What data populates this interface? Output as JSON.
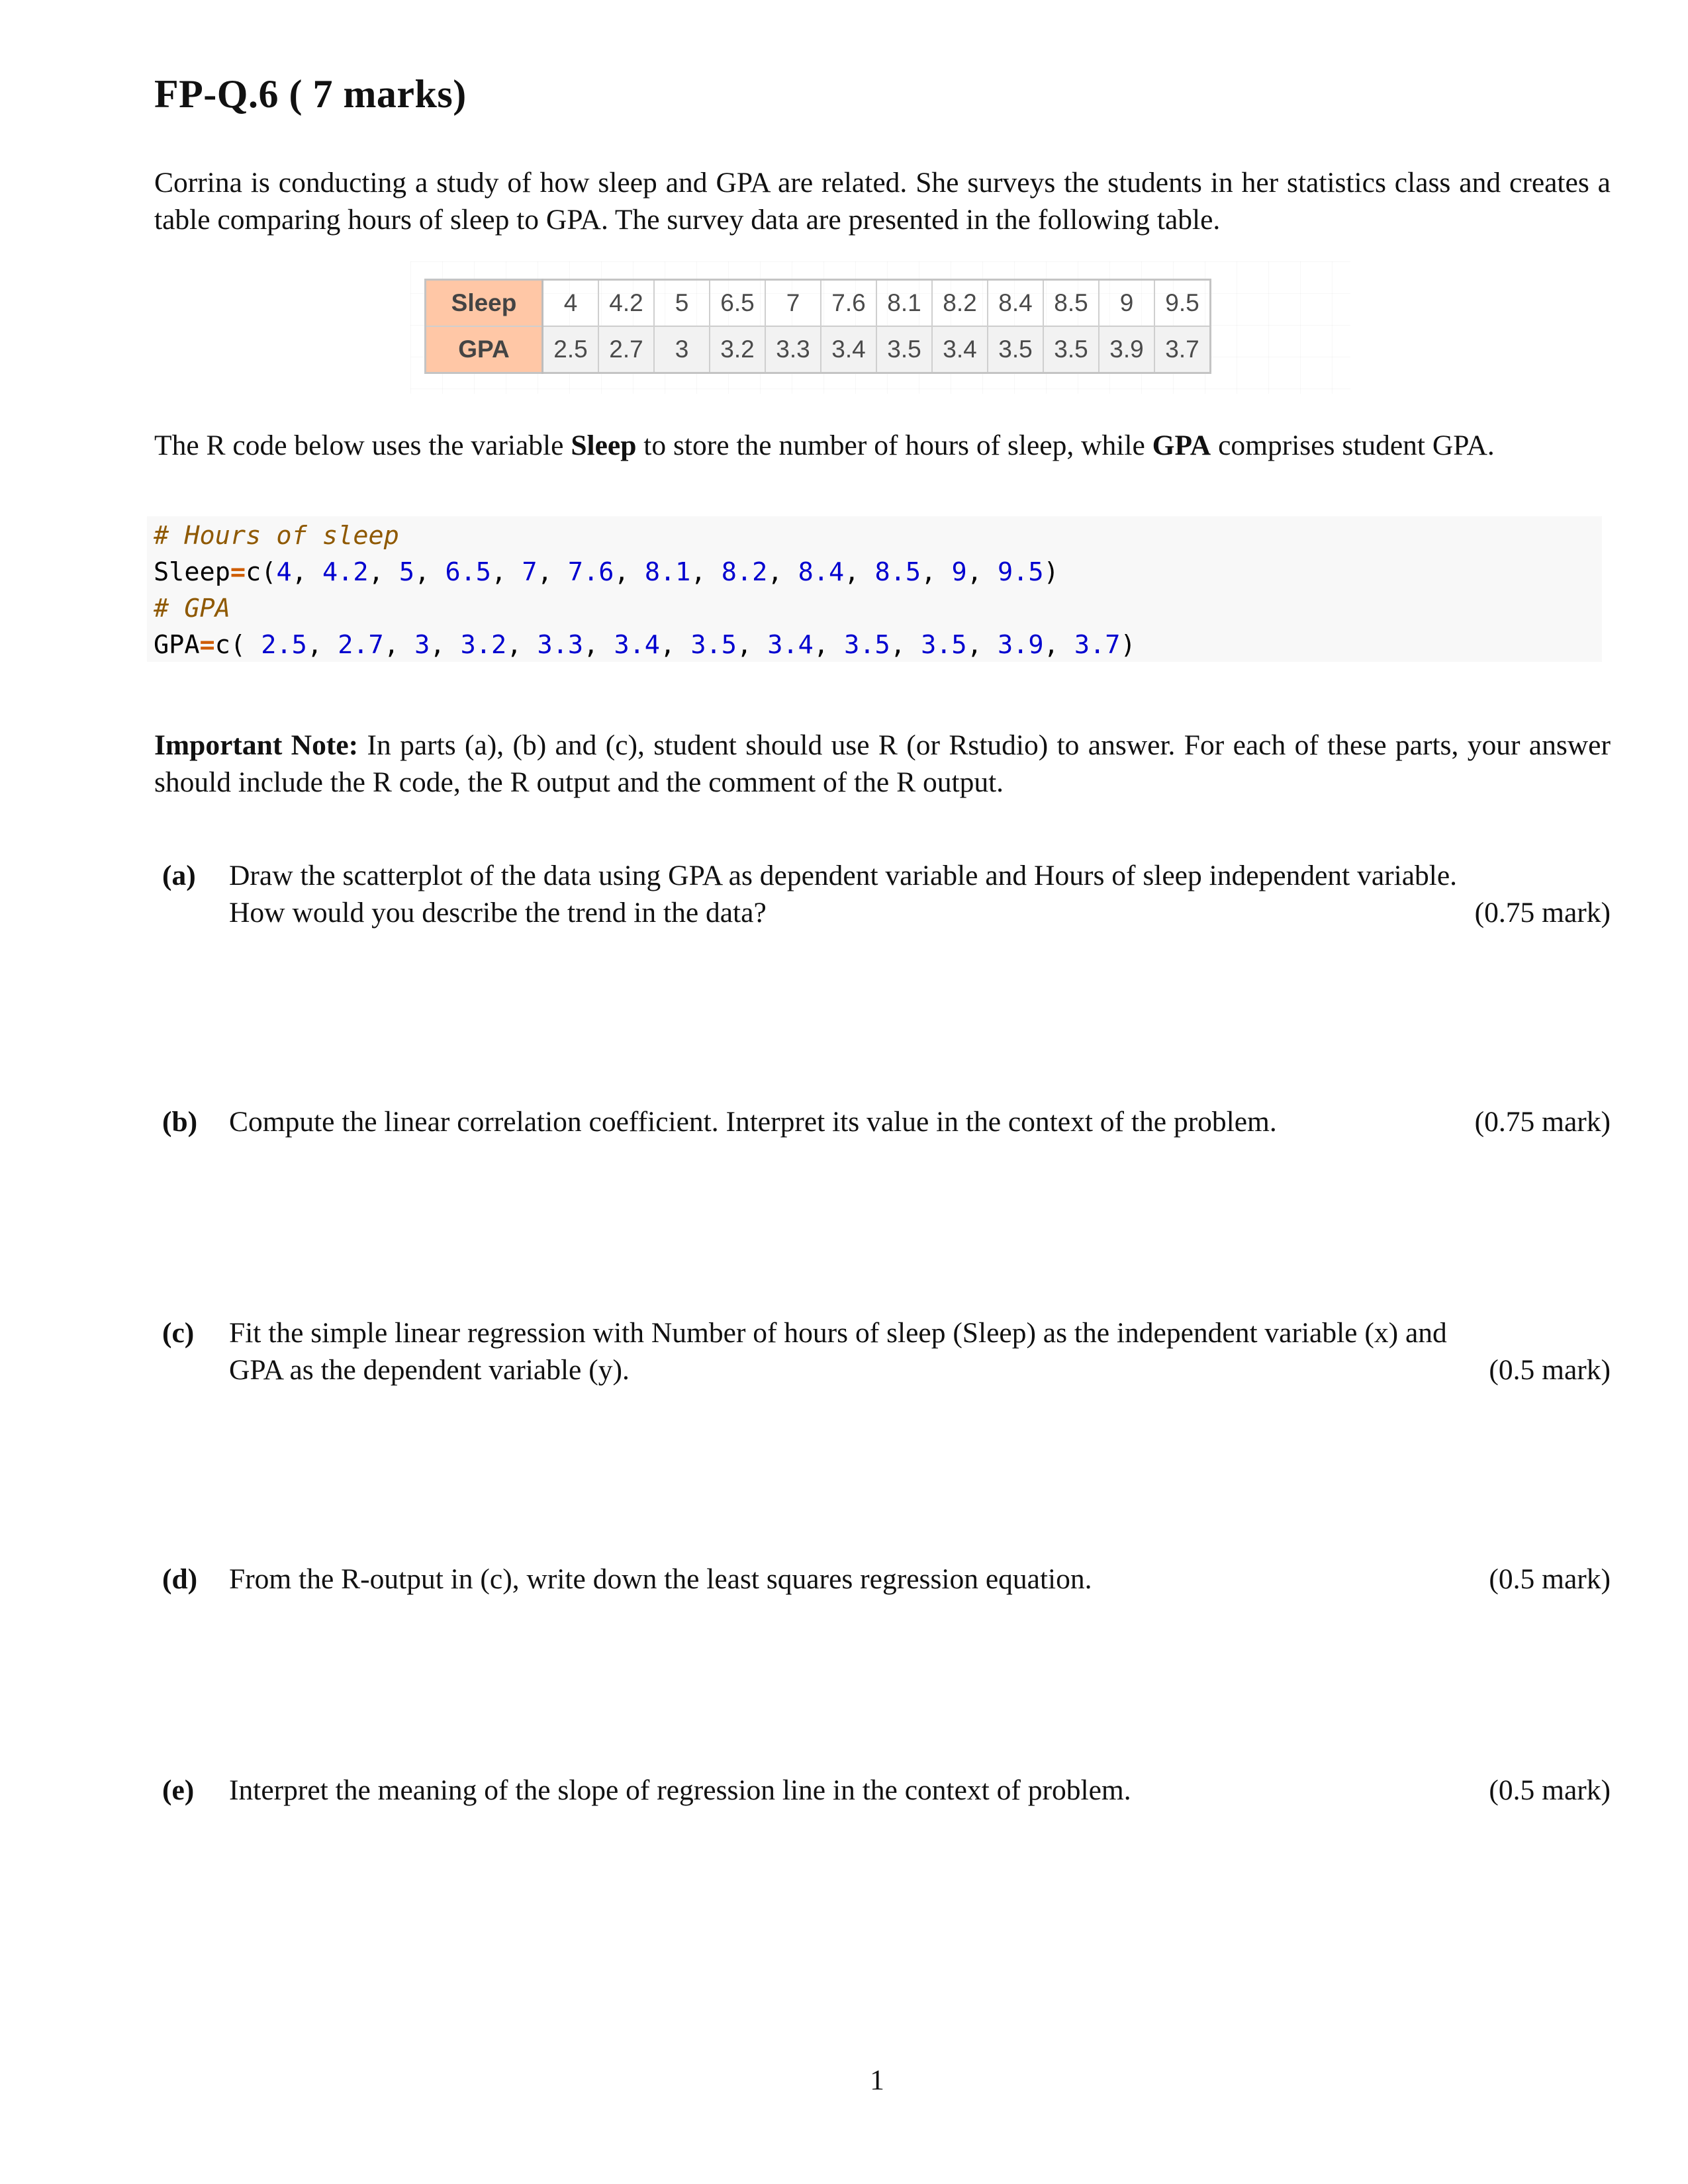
{
  "header": {
    "title_prefix": "FP-Q.6 (",
    "title_marks": "7",
    "title_suffix": "marks)"
  },
  "intro": {
    "text": "Corrina is conducting a study of how sleep and GPA are related. She surveys the students in her statistics class and creates a table comparing hours of sleep to GPA. The survey data are presented in the following table."
  },
  "table": {
    "row_headers": [
      "Sleep",
      "GPA"
    ],
    "sleep": [
      "4",
      "4.2",
      "5",
      "6.5",
      "7",
      "7.6",
      "8.1",
      "8.2",
      "8.4",
      "8.5",
      "9",
      "9.5"
    ],
    "gpa": [
      "2.5",
      "2.7",
      "3",
      "3.2",
      "3.3",
      "3.4",
      "3.5",
      "3.4",
      "3.5",
      "3.5",
      "3.9",
      "3.7"
    ],
    "header_color": "#ffc7a6"
  },
  "code_intro": {
    "part1": "The R code below uses the variable ",
    "bold1": "Sleep",
    "part2": " to store the number of hours of sleep, while ",
    "bold2": "GPA",
    "part3": " comprises student GPA."
  },
  "code": {
    "comment1": "# Hours of sleep",
    "line1_var": "Sleep",
    "line1_op": "=",
    "line1_fn": "c(",
    "line1_values": [
      "4",
      "4.2",
      "5",
      "6.5",
      "7",
      "7.6",
      "8.1",
      "8.2",
      "8.4",
      "8.5",
      "9",
      "9.5"
    ],
    "comment2": "# GPA",
    "line2_var": "GPA",
    "line2_op": "=",
    "line2_fn": "c( ",
    "line2_values": [
      "2.5",
      "2.7",
      "3",
      "3.2",
      "3.3",
      "3.4",
      "3.5",
      "3.4",
      "3.5",
      "3.5",
      "3.9",
      "3.7"
    ],
    "close": ")",
    "colors": {
      "comment": "#8f5902",
      "number": "#0000cf",
      "operator": "#ce5c00"
    }
  },
  "note": {
    "label": "Important Note:",
    "text": " In parts (a), (b) and (c), student should use R (or Rstudio) to answer. For each of these parts, your answer should include the R code, the R output and the comment of the R output."
  },
  "parts": [
    {
      "label": "(a)",
      "line1": "Draw the scatterplot of the data using GPA as dependent variable and Hours of sleep independent variable.",
      "line2": "How would you describe the trend in the data?",
      "marks": "(0.75 mark)"
    },
    {
      "label": "(b)",
      "line1": "Compute the linear correlation coefficient. Interpret its value in the context of the problem.",
      "line2": "",
      "marks": "(0.75 mark)"
    },
    {
      "label": "(c)",
      "line1": "Fit the simple linear regression with Number of hours of sleep (Sleep) as the independent variable (x) and",
      "line2": "GPA as the dependent variable (y).",
      "marks": "(0.5 mark)"
    },
    {
      "label": "(d)",
      "line1": "From the R-output in (c), write down the least squares regression equation.",
      "line2": "",
      "marks": "(0.5 mark)"
    },
    {
      "label": "(e)",
      "line1": "Interpret the meaning of the slope of regression line in the context of problem.",
      "line2": "",
      "marks": "(0.5 mark)"
    }
  ],
  "footer": {
    "page_number": "1"
  }
}
